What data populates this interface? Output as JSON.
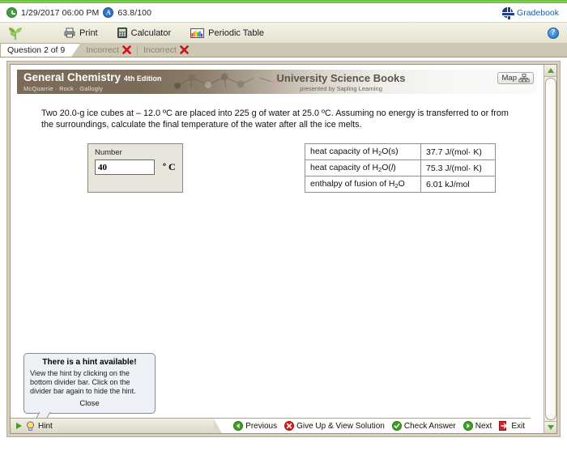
{
  "statusbar": {
    "clock_icon": "clock-icon",
    "datetime": "1/29/2017 06:00 PM",
    "grade_icon": "grade-badge-icon",
    "score": "63.8/100",
    "globe_icon": "globe-icon",
    "gradebook_label": "Gradebook",
    "gradebook_color": "#1a5fa8"
  },
  "toolbar": {
    "logo_icon": "leaf-logo-icon",
    "print_icon": "printer-icon",
    "print_label": "Print",
    "calculator_icon": "calculator-icon",
    "calculator_label": "Calculator",
    "periodic_icon": "periodic-table-icon",
    "periodic_label": "Periodic Table",
    "help_icon": "help-icon",
    "help_label": "?"
  },
  "tabs": {
    "active": "Question 2 of 9",
    "others": [
      {
        "label": "Incorrect",
        "status_icon": "red-x-icon"
      },
      {
        "label": "Incorrect",
        "status_icon": "red-x-icon"
      }
    ]
  },
  "banner": {
    "title": "General Chemistry",
    "edition": "4th Edition",
    "authors": "McQuarrie · Rock · Gallogly",
    "publisher": "University Science Books",
    "presented_by": "presented by Sapling Learning",
    "map_label": "Map",
    "map_icon": "sitemap-icon"
  },
  "question": {
    "text": "Two 20.0-g ice cubes at – 12.0 ºC are placed into 225 g of water at 25.0 ºC. Assuming no energy is transferred to or from the surroundings, calculate the final temperature of the water after all the ice melts."
  },
  "answer": {
    "field_label": "Number",
    "value": "40",
    "placeholder": "",
    "unit": "º C"
  },
  "data_table": {
    "rows": [
      {
        "quantity_prefix": "heat capacity of H",
        "sub1": "2",
        "quantity_mid": "O(s)",
        "italic_state": "",
        "value": "37.7 J/(mol· K)"
      },
      {
        "quantity_prefix": "heat capacity of H",
        "sub1": "2",
        "quantity_mid": "O(",
        "italic_state": "l",
        "value": "75.3 J/(mol· K)"
      },
      {
        "quantity_prefix": "enthalpy of fusion of H",
        "sub1": "2",
        "quantity_mid": "O",
        "italic_state": "",
        "value": "6.01 kJ/mol"
      }
    ]
  },
  "hint_popup": {
    "title": "There is a hint available!",
    "body": "View the hint by clicking on the bottom divider bar. Click on the divider bar again to hide the hint.",
    "close_label": "Close"
  },
  "bottombar": {
    "hint_arrow_icon": "play-triangle-icon",
    "hint_bulb_icon": "lightbulb-icon",
    "hint_label": "Hint",
    "nav_items": [
      {
        "label": "Previous",
        "icon": "green-back-arrow-icon"
      },
      {
        "label": "Give Up & View Solution",
        "icon": "red-x-circle-icon"
      },
      {
        "label": "Check Answer",
        "icon": "green-check-circle-icon"
      },
      {
        "label": "Next",
        "icon": "green-forward-arrow-icon"
      },
      {
        "label": "Exit",
        "icon": "red-exit-door-icon"
      }
    ]
  },
  "scrollbar": {
    "up_icon": "scroll-up-arrow-icon",
    "down_icon": "scroll-down-arrow-icon"
  }
}
